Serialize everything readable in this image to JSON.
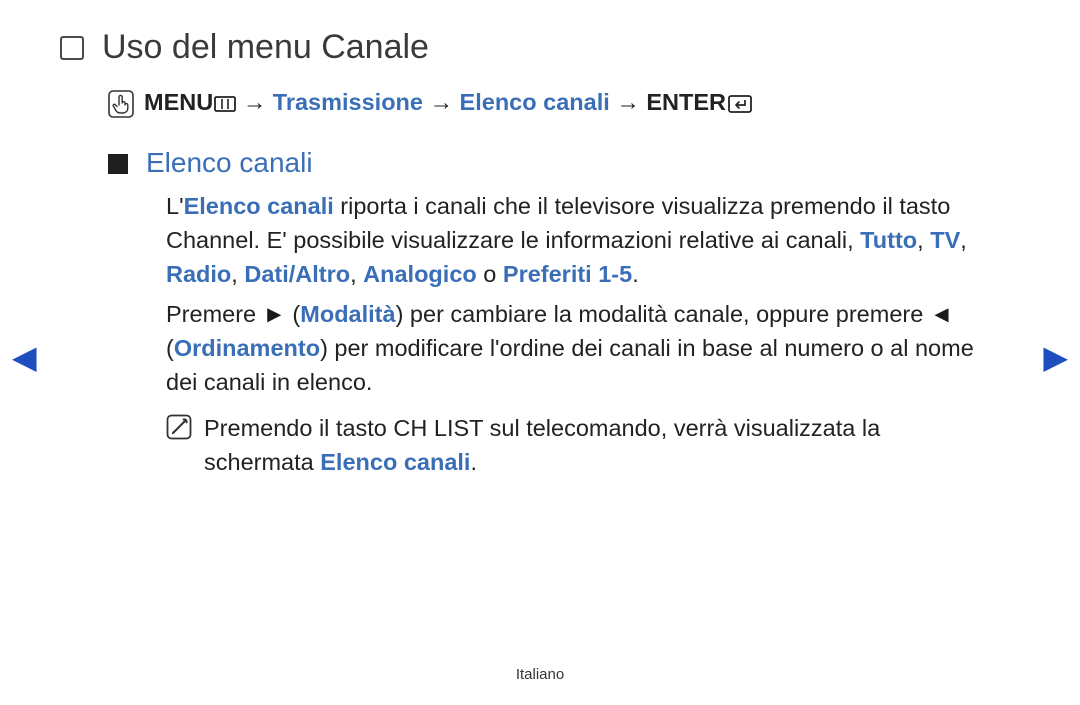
{
  "title": "Uso del menu Canale",
  "breadcrumb": {
    "menu": "MENU",
    "step1": "Trasmissione",
    "step2": "Elenco canali",
    "enter": "ENTER",
    "sep": "→"
  },
  "section": {
    "title": "Elenco canali",
    "p1_a": "L'",
    "p1_b": "Elenco canali",
    "p1_c": " riporta i canali che il televisore visualizza premendo il tasto Channel. E' possibile visualizzare le informazioni relative ai canali, ",
    "p1_tutto": "Tutto",
    "p1_comma1": ", ",
    "p1_tv": "TV",
    "p1_comma2": ", ",
    "p1_radio": "Radio",
    "p1_comma3": ", ",
    "p1_dati": "Dati/Altro",
    "p1_comma4": ", ",
    "p1_analog": "Analogico",
    "p1_o": " o ",
    "p1_pref": "Preferiti 1-5",
    "p1_period": ".",
    "p2_a": "Premere ",
    "p2_tri_r": "►",
    "p2_b": " (",
    "p2_mod": "Modalità",
    "p2_c": ") per cambiare la modalità canale, oppure premere ",
    "p2_tri_l": "◄",
    "p2_d": " (",
    "p2_ord": "Ordinamento",
    "p2_e": ") per modificare l'ordine dei canali in base al numero o al nome dei canali in elenco."
  },
  "note": {
    "a": "Premendo il tasto ",
    "chlist": "CH LIST",
    "b": " sul telecomando, verrà visualizzata la schermata ",
    "elenco": "Elenco canali",
    "period": "."
  },
  "nav": {
    "left": "◀",
    "right": "▶"
  },
  "footer": "Italiano"
}
